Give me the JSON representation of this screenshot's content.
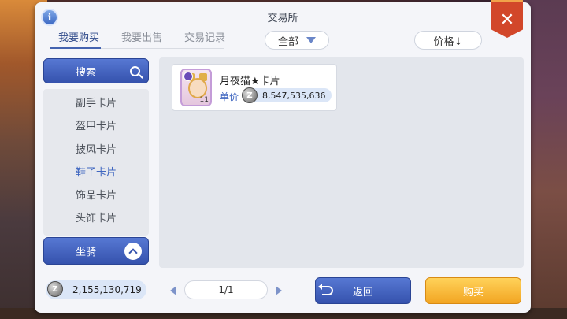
{
  "window": {
    "title": "交易所",
    "close_symbol": "✕",
    "info_symbol": "i"
  },
  "tabs": [
    {
      "label": "我要购买",
      "active": true
    },
    {
      "label": "我要出售",
      "active": false
    },
    {
      "label": "交易记录",
      "active": false
    }
  ],
  "filter": {
    "selected": "全部"
  },
  "sort": {
    "label": "价格↓"
  },
  "sidebar": {
    "search_label": "搜索",
    "categories": [
      {
        "label": "副手卡片",
        "selected": false
      },
      {
        "label": "盔甲卡片",
        "selected": false
      },
      {
        "label": "披风卡片",
        "selected": false
      },
      {
        "label": "鞋子卡片",
        "selected": true
      },
      {
        "label": "饰品卡片",
        "selected": false
      },
      {
        "label": "头饰卡片",
        "selected": false
      }
    ],
    "mount_label": "坐骑"
  },
  "listing": {
    "item_name": "月夜猫★卡片",
    "price_label": "单价",
    "price": "8,547,535,636",
    "count": "11"
  },
  "footer": {
    "money": "2,155,130,719",
    "page": "1/1",
    "back_label": "返回",
    "buy_label": "购买"
  },
  "colors": {
    "accent_blue": "#3552ad",
    "buy_orange": "#f2a522",
    "close_red": "#d2472a"
  },
  "icons": {
    "coin": "z-coin-icon"
  }
}
